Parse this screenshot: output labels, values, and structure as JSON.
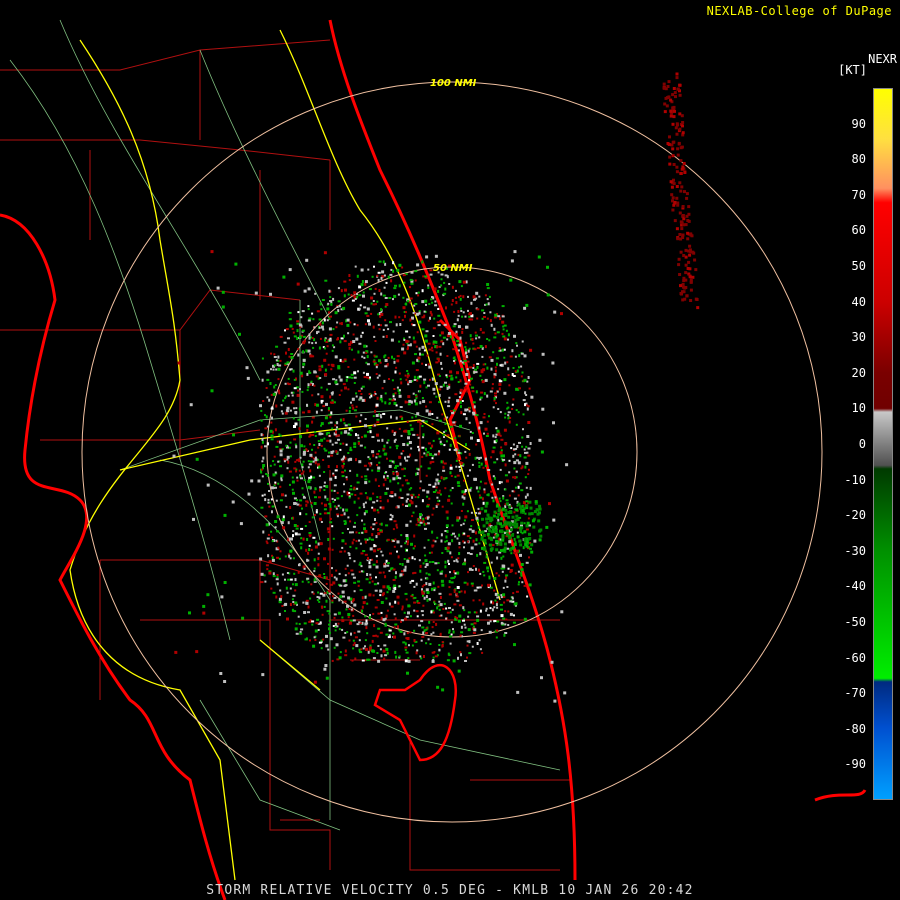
{
  "header": {
    "credit": "NEXLAB-College of DuPage"
  },
  "footer": {
    "product_label": "STORM RELATIVE VELOCITY 0.5 DEG - KMLB 10 JAN 26 20:42"
  },
  "legend": {
    "title": "NEXR",
    "unit": "[KT]",
    "ticks": [
      "90",
      "80",
      "70",
      "60",
      "50",
      "40",
      "30",
      "20",
      "10",
      "0",
      "-10",
      "-20",
      "-30",
      "-40",
      "-50",
      "-60",
      "-70",
      "-80",
      "-90"
    ],
    "range": [
      -100,
      100
    ],
    "color_stops": [
      {
        "value": 100,
        "color": "#ffff00"
      },
      {
        "value": 86,
        "color": "#ffe040"
      },
      {
        "value": 72,
        "color": "#ff9060"
      },
      {
        "value": 68,
        "color": "#ff0000"
      },
      {
        "value": 40,
        "color": "#cc0000"
      },
      {
        "value": 20,
        "color": "#7a0000"
      },
      {
        "value": 10,
        "color": "#700000"
      },
      {
        "value": 9,
        "color": "#c8c8c8"
      },
      {
        "value": 0,
        "color": "#808080"
      },
      {
        "value": -6,
        "color": "#505050"
      },
      {
        "value": -7,
        "color": "#003a00"
      },
      {
        "value": -30,
        "color": "#009000"
      },
      {
        "value": -66,
        "color": "#00ee00"
      },
      {
        "value": -67,
        "color": "#002a80"
      },
      {
        "value": -80,
        "color": "#0050d0"
      },
      {
        "value": -100,
        "color": "#00a0ff"
      }
    ]
  },
  "range_rings": [
    {
      "label": "100 NMI",
      "nmi": 100
    },
    {
      "label": "50 NMI",
      "nmi": 50
    }
  ],
  "colors": {
    "coastline": "#ff0000",
    "county_lines": "#b01010",
    "highways": "#ffff00",
    "roads": "#80c080",
    "range_rings": "#f0c0a0",
    "inbound": "#00b000",
    "outbound": "#b00000",
    "near_zero": "#c0c0c0"
  },
  "map": {
    "radar_site": "KMLB"
  }
}
